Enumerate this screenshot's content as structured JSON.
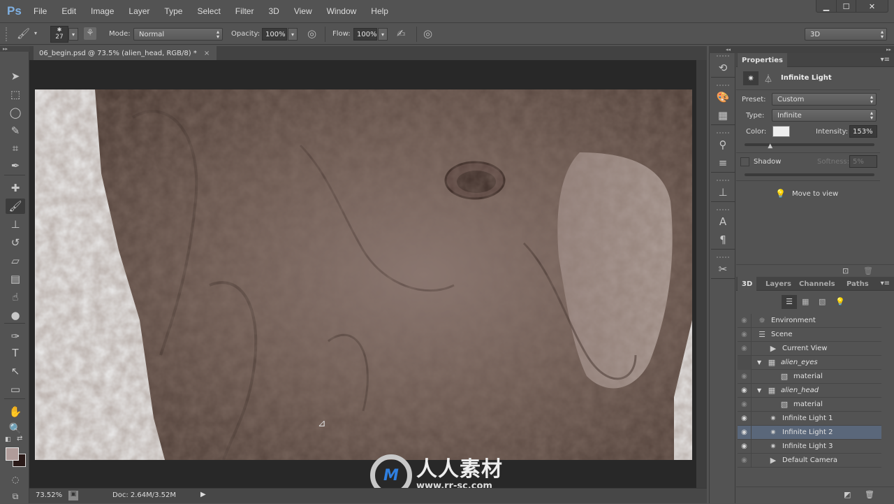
{
  "app": {
    "logo": "Ps",
    "window_controls": {
      "minimize": "▁",
      "maximize": "☐",
      "close": "✕"
    }
  },
  "menu": [
    "File",
    "Edit",
    "Image",
    "Layer",
    "Type",
    "Select",
    "Filter",
    "3D",
    "View",
    "Window",
    "Help"
  ],
  "options_bar": {
    "brush_size": "27",
    "mode_label": "Mode:",
    "mode_value": "Normal",
    "opacity_label": "Opacity:",
    "opacity_value": "100%",
    "flow_label": "Flow:",
    "flow_value": "100%",
    "workspace": "3D"
  },
  "document": {
    "tab_title": "06_begin.psd @ 73.5% (alien_head, RGB/8) *",
    "close_glyph": "×",
    "canvas_bg": "#ececec",
    "image_description": "Close-up render of textured alien head, brown skin tones"
  },
  "status": {
    "zoom": "73.52%",
    "doc_size": "Doc: 2.64M/3.52M",
    "arrow": "▶"
  },
  "tools": [
    {
      "name": "move-tool",
      "glyph": "➤"
    },
    {
      "name": "marquee-tool",
      "glyph": "⬚"
    },
    {
      "name": "lasso-tool",
      "glyph": "◯"
    },
    {
      "name": "quick-selection-tool",
      "glyph": "✎"
    },
    {
      "name": "crop-tool",
      "glyph": "⌗"
    },
    {
      "name": "eyedropper-tool",
      "glyph": "✒"
    },
    {
      "name": "healing-brush-tool",
      "glyph": "✚"
    },
    {
      "name": "brush-tool",
      "glyph": "🖌"
    },
    {
      "name": "clone-stamp-tool",
      "glyph": "⊥"
    },
    {
      "name": "history-brush-tool",
      "glyph": "↺"
    },
    {
      "name": "eraser-tool",
      "glyph": "▱"
    },
    {
      "name": "gradient-tool",
      "glyph": "▤"
    },
    {
      "name": "blur-tool",
      "glyph": "☝"
    },
    {
      "name": "dodge-tool",
      "glyph": "●"
    },
    {
      "name": "pen-tool",
      "glyph": "✑"
    },
    {
      "name": "type-tool",
      "glyph": "T"
    },
    {
      "name": "path-selection-tool",
      "glyph": "↖"
    },
    {
      "name": "rectangle-tool",
      "glyph": "▭"
    },
    {
      "name": "hand-tool",
      "glyph": "✋"
    },
    {
      "name": "zoom-tool",
      "glyph": "🔍"
    }
  ],
  "colors": {
    "foreground": "#b09c9a",
    "background": "#2a1a18",
    "accent_selected_row": "#5a677a"
  },
  "dock_icons": [
    {
      "name": "history-icon",
      "glyph": "⟲"
    },
    {
      "name": "color-palette-icon",
      "glyph": "🎨"
    },
    {
      "name": "swatches-icon",
      "glyph": "▦"
    },
    {
      "name": "brush-presets-icon",
      "glyph": "⚲"
    },
    {
      "name": "brush-panel-icon",
      "glyph": "≡"
    },
    {
      "name": "clone-source-icon",
      "glyph": "⊥"
    },
    {
      "name": "character-icon",
      "glyph": "A"
    },
    {
      "name": "paragraph-icon",
      "glyph": "¶"
    },
    {
      "name": "tool-presets-icon",
      "glyph": "✂"
    }
  ],
  "properties": {
    "tab": "Properties",
    "title": "Infinite Light",
    "preset_label": "Preset:",
    "preset_value": "Custom",
    "type_label": "Type:",
    "type_value": "Infinite",
    "color_label": "Color:",
    "color_value": "#eeeeee",
    "intensity_label": "Intensity:",
    "intensity_value": "153%",
    "intensity_slider_fraction": 0.2,
    "shadow_label": "Shadow",
    "shadow_checked": false,
    "softness_label": "Softness:",
    "softness_value": "5%",
    "move_to_view": "Move to view"
  },
  "scene_panel": {
    "tabs": [
      "3D",
      "Layers",
      "Channels",
      "Paths"
    ],
    "active_tab": "3D",
    "rows": [
      {
        "label": "Environment",
        "icon": "☼",
        "indent": 0,
        "eye": "dim",
        "italic": false,
        "expand": false
      },
      {
        "label": "Scene",
        "icon": "☰",
        "indent": 0,
        "eye": "dim",
        "italic": false,
        "expand": false
      },
      {
        "label": "Current View",
        "icon": "▶",
        "indent": 1,
        "eye": "dim",
        "italic": false,
        "expand": false
      },
      {
        "label": "alien_eyes",
        "icon": "▦",
        "indent": 0,
        "eye": "none",
        "italic": true,
        "expand": true
      },
      {
        "label": "material",
        "icon": "▧",
        "indent": 2,
        "eye": "dim",
        "italic": false,
        "expand": false
      },
      {
        "label": "alien_head",
        "icon": "▦",
        "indent": 0,
        "eye": "on",
        "italic": true,
        "expand": true
      },
      {
        "label": "material",
        "icon": "▧",
        "indent": 2,
        "eye": "dim",
        "italic": false,
        "expand": false
      },
      {
        "label": "Infinite Light 1",
        "icon": "✷",
        "indent": 1,
        "eye": "on",
        "italic": false,
        "expand": false
      },
      {
        "label": "Infinite Light 2",
        "icon": "✷",
        "indent": 1,
        "eye": "on",
        "italic": false,
        "expand": false,
        "selected": true
      },
      {
        "label": "Infinite Light 3",
        "icon": "✷",
        "indent": 1,
        "eye": "on",
        "italic": false,
        "expand": false
      },
      {
        "label": "Default Camera",
        "icon": "▶",
        "indent": 1,
        "eye": "dim",
        "italic": false,
        "expand": false
      }
    ]
  },
  "watermark": {
    "cn": "人人素材",
    "url": "www.rr-sc.com"
  }
}
